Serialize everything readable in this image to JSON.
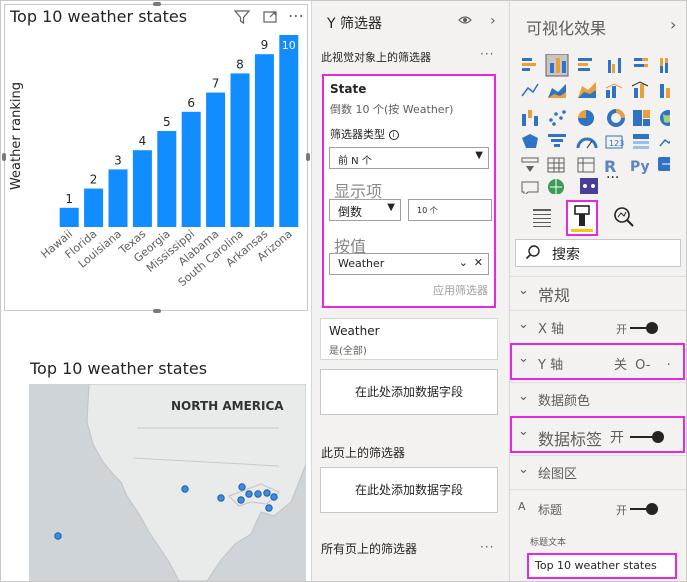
{
  "chart": {
    "title": "Top 10 weather states",
    "ylabel": "Weather ranking"
  },
  "chart_data": {
    "type": "bar",
    "title": "Top 10 weather states",
    "xlabel": "",
    "ylabel": "Weather ranking",
    "categories": [
      "Hawaii",
      "Florida",
      "Louisiana",
      "Texas",
      "Georgia",
      "Mississippi",
      "Alabama",
      "South Carolina",
      "Arkansas",
      "Arizona"
    ],
    "values": [
      1,
      2,
      3,
      4,
      5,
      6,
      7,
      8,
      9,
      10
    ],
    "ylim": [
      0,
      10
    ],
    "grid": false,
    "bar_color": "#118dff",
    "data_labels": true
  },
  "map": {
    "title": "Top 10 weather states",
    "region_label": "NORTH AMERICA"
  },
  "filters": {
    "pane_title": "Y 筛选器",
    "visual_section": "此视觉对象上的筛选器",
    "state_card": {
      "title": "State",
      "subtitle": "倒数 10 个(按 Weather)",
      "filter_type_label": "筛选器类型",
      "filter_type_value": "前 N 个",
      "show_items_label": "显示项",
      "direction_value": "倒数",
      "count_value": "10 个",
      "by_value_label": "按值",
      "by_value_field": "Weather",
      "apply_label": "应用筛选器"
    },
    "weather_card": {
      "title": "Weather",
      "subtitle": "是(全部)"
    },
    "add_field_label": "在此处添加数据字段",
    "page_section": "此页上的筛选器",
    "page_add_field_label": "在此处添加数据字段",
    "all_pages_section": "所有页上的筛选器"
  },
  "viz": {
    "pane_title": "可视化效果",
    "search_placeholder": "搜索",
    "more": "···",
    "sections": {
      "general": "常规",
      "x_axis": "X 轴",
      "x_axis_toggle": "开",
      "y_axis": "Y 轴",
      "y_axis_toggle": "关",
      "data_colors": "数据颜色",
      "data_labels": "数据标签",
      "data_labels_toggle": "开",
      "plot_area": "绘图区",
      "title": "标题",
      "title_toggle": "开",
      "title_text_label": "标题文本",
      "title_text_value": "Top 10 weather states"
    },
    "icons": {
      "r": "R",
      "py": "Py"
    }
  },
  "colors": {
    "accent": "#118dff",
    "highlight": "#e32ade",
    "format_tab": "#f2c811"
  }
}
